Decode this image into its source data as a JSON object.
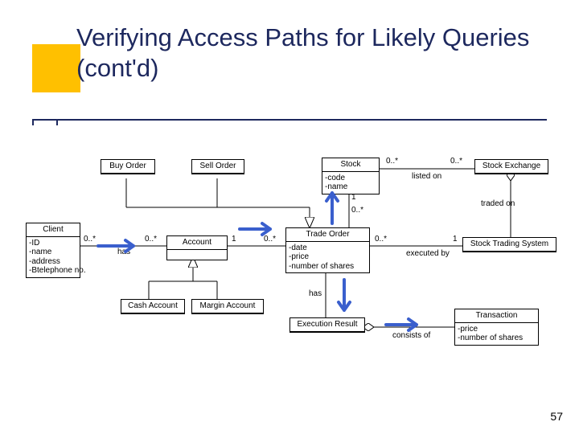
{
  "colors": {
    "accent": "#ffc000",
    "title": "#1d285e",
    "guide_arrow": "#3a5fcd"
  },
  "title": "Verifying Access Paths for Likely Queries (cont'd)",
  "page_number": "57",
  "classes": {
    "buy_order": {
      "name": "Buy Order",
      "attrs": []
    },
    "sell_order": {
      "name": "Sell Order",
      "attrs": []
    },
    "stock": {
      "name": "Stock",
      "attrs": [
        "-code",
        "-name"
      ]
    },
    "stock_exchange": {
      "name": "Stock Exchange",
      "attrs": []
    },
    "client": {
      "name": "Client",
      "attrs": [
        "-ID",
        "-name",
        "-address",
        "-Btelephone no."
      ]
    },
    "account": {
      "name": "Account",
      "attrs": []
    },
    "trade_order": {
      "name": "Trade Order",
      "attrs": [
        "-date",
        "-price",
        "-number of shares"
      ]
    },
    "stock_trading_sys": {
      "name": "Stock Trading System",
      "attrs": []
    },
    "cash_account": {
      "name": "Cash Account",
      "attrs": []
    },
    "margin_account": {
      "name": "Margin Account",
      "attrs": []
    },
    "execution_result": {
      "name": "Execution Result",
      "attrs": []
    },
    "transaction": {
      "name": "Transaction",
      "attrs": [
        "-price",
        "-number of shares"
      ]
    }
  },
  "associations": {
    "listed_on": {
      "label": "listed on",
      "mult_left": "0..*",
      "mult_right": "0..*"
    },
    "traded_on": {
      "label": "traded on"
    },
    "has_account": {
      "label": "has",
      "mult_left": "0..*",
      "mult_right": "0..*"
    },
    "acct_trade": {
      "mult_left": "1",
      "mult_right": "0..*"
    },
    "trade_stock": {
      "mult_bottom": "0..*",
      "mult_top": "1"
    },
    "executed_by": {
      "label": "executed by",
      "mult_left": "0..*",
      "mult_right": "1"
    },
    "has_result": {
      "label": "has"
    },
    "consists_of": {
      "label": "consists of"
    }
  },
  "guide_arrows": [
    {
      "id": "to-account",
      "desc": "right arrow from Client toward Account"
    },
    {
      "id": "to-tradeorder",
      "desc": "right arrow from Account toward Trade Order"
    },
    {
      "id": "to-stock",
      "desc": "up arrow from Trade Order toward Stock"
    },
    {
      "id": "to-execres",
      "desc": "down arrow from Trade Order toward Execution Result"
    },
    {
      "id": "to-transaction",
      "desc": "right arrow from Execution Result toward Transaction"
    }
  ]
}
